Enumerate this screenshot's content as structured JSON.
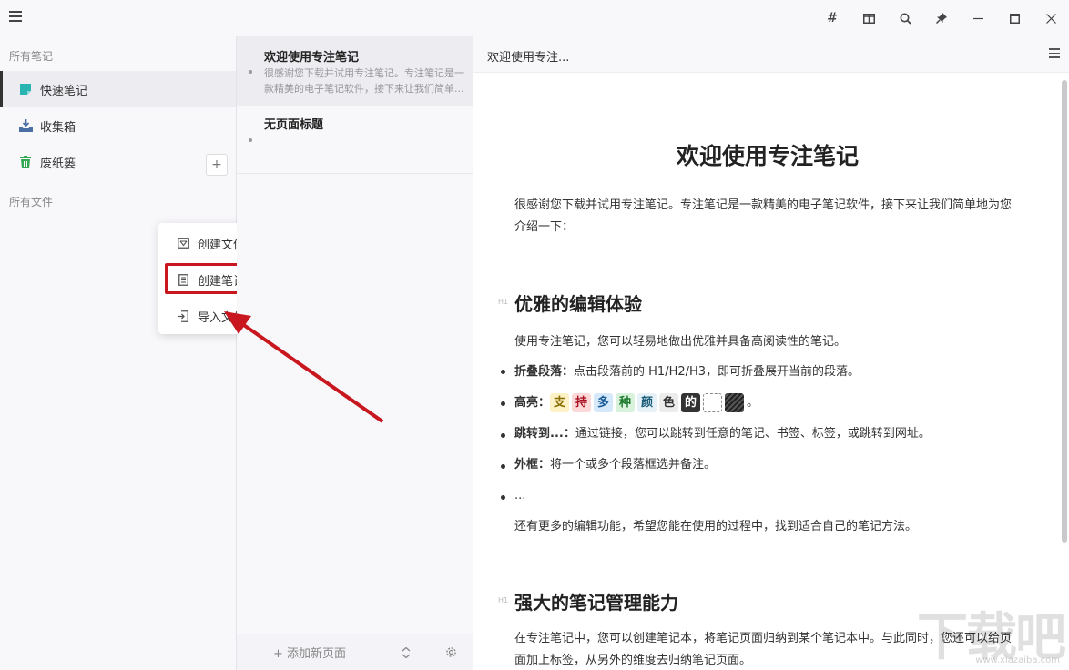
{
  "titlebar": {
    "controls": [
      "hash-icon",
      "split-view-icon",
      "search-icon",
      "pin-icon",
      "minimize-icon",
      "maximize-icon",
      "close-icon"
    ]
  },
  "sidebar": {
    "all_notes_label": "所有笔记",
    "items": [
      {
        "label": "快速笔记",
        "icon": "quick-note-icon",
        "color": "#2ab3b3"
      },
      {
        "label": "收集箱",
        "icon": "inbox-icon",
        "color": "#4a6fa5"
      },
      {
        "label": "废纸篓",
        "icon": "trash-icon",
        "color": "#34a853"
      }
    ],
    "all_files_label": "所有文件",
    "add_label": "+"
  },
  "dropdown": {
    "items": [
      {
        "label": "创建文件夹",
        "icon": "folder-icon"
      },
      {
        "label": "创建笔记本",
        "icon": "notebook-icon"
      },
      {
        "label": "导入文件",
        "icon": "import-icon"
      }
    ]
  },
  "notelist": {
    "notes": [
      {
        "title": "欢迎使用专注笔记",
        "snippet": "很感谢您下载并试用专注笔记。专注笔记是一款精美的电子笔记软件，接下来让我们简单..."
      },
      {
        "title": "无页面标题",
        "snippet": ""
      }
    ],
    "add_page_label": "+ 添加新页面"
  },
  "editor": {
    "header_title": "欢迎使用专注...",
    "doc_title": "欢迎使用专注笔记",
    "intro": "很感谢您下载并试用专注笔记。专注笔记是一款精美的电子笔记软件，接下来让我们简单地为您介绍一下：",
    "h_mark": "H1",
    "section1_title": "优雅的编辑体验",
    "section1_intro": "使用专注笔记，您可以轻易地做出优雅并具备高阅读性的笔记。",
    "bullets": [
      {
        "bold": "折叠段落：",
        "text": "点击段落前的 H1/H2/H3，即可折叠展开当前的段落。"
      },
      {
        "bold": "高亮：",
        "text": ""
      },
      {
        "bold": "跳转到...：",
        "text": "通过链接，您可以跳转到任意的笔记、书签、标签，或跳转到网址。"
      },
      {
        "bold": "外框：",
        "text": "将一个或多个段落框选并备注。"
      },
      {
        "bold": "",
        "text": "..."
      }
    ],
    "highlight_chips": [
      {
        "char": "支",
        "bg": "#fdf1c6",
        "color": "#8a6d00"
      },
      {
        "char": "持",
        "bg": "#fbd9d9",
        "color": "#a12"
      },
      {
        "char": "多",
        "bg": "#d6e9fb",
        "color": "#1a5c99"
      },
      {
        "char": "种",
        "bg": "#d9f2dc",
        "color": "#1d7a2d"
      },
      {
        "char": "颜",
        "bg": "#e6f2f7",
        "color": "#1a5c7a"
      },
      {
        "char": "色",
        "bg": "#ececec",
        "color": "#333"
      },
      {
        "char": "的",
        "bg": "#333333",
        "color": "#fff"
      }
    ],
    "highlight_end": "。",
    "more_features": "还有更多的编辑功能，希望您能在使用的过程中，找到适合自己的笔记方法。",
    "section2_title": "强大的笔记管理能力",
    "section2_text": "在专注笔记中，您可以创建笔记本，将笔记页面归纳到某个笔记本中。与此同时，您还可以给页面加上标签，从另外的维度去归纳笔记页面。"
  },
  "watermark": {
    "text": "下载吧",
    "small": "www.xiazaiba.com"
  }
}
